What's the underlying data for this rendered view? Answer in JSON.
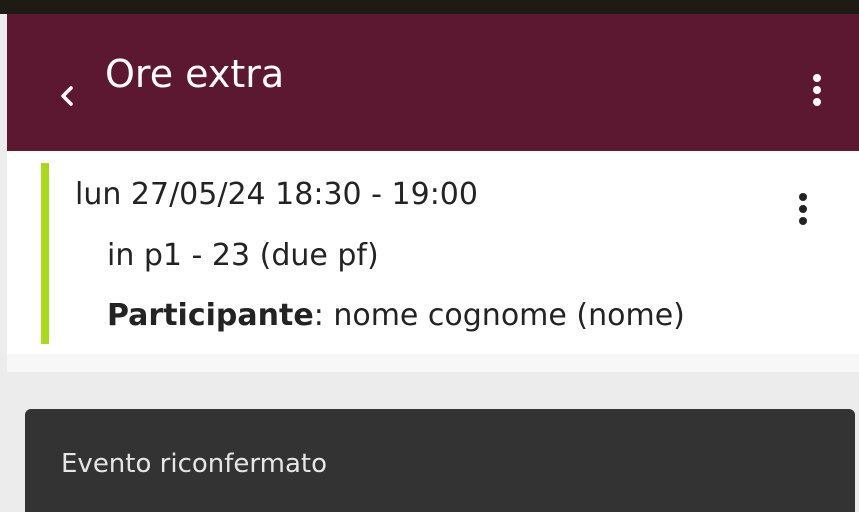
{
  "app_bar": {
    "title": "Ore extra",
    "back_icon": "chevron-left-icon",
    "menu_icon": "more-vert-icon"
  },
  "event_card": {
    "date_time": "lun 27/05/24 18:30 - 19:00",
    "location": "in p1 - 23 (due pf)",
    "participant_label": "Participante",
    "participant_value": ": nome cognome (nome)",
    "menu_icon": "more-vert-icon",
    "accent_color": "#a9d81d"
  },
  "snackbar": {
    "message": "Evento riconfermato"
  },
  "colors": {
    "app_bar": "#5c1830",
    "snackbar": "#333333"
  }
}
